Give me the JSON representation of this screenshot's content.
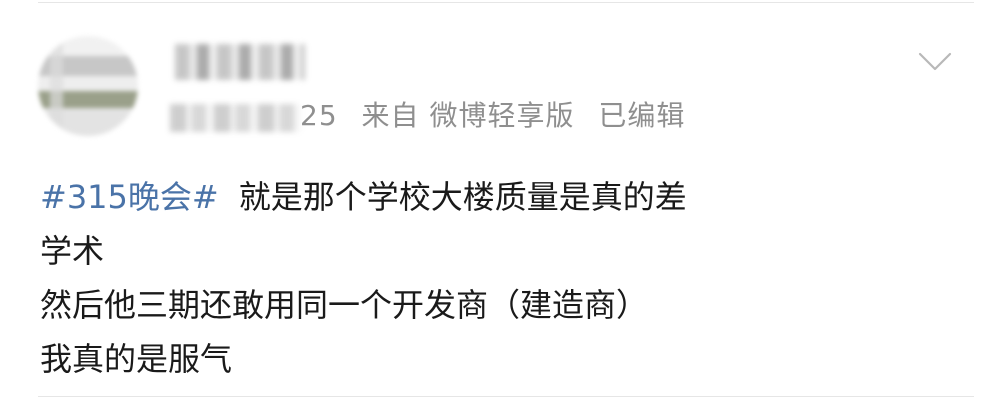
{
  "post": {
    "meta_suffix": "25",
    "source": "来自 微博轻享版",
    "edited": "已编辑",
    "hashtag": "#315晚会#",
    "lines": [
      "就是那个学校大楼质量是真的差",
      "学术",
      "然后他三期还敢用同一个开发商（建造商）",
      "我真的是服气"
    ]
  },
  "icons": {
    "expand": "chevron-down-icon"
  },
  "colors": {
    "hashtag": "#4a73a8",
    "meta": "#8f8f8f",
    "text": "#1a1a1a"
  }
}
